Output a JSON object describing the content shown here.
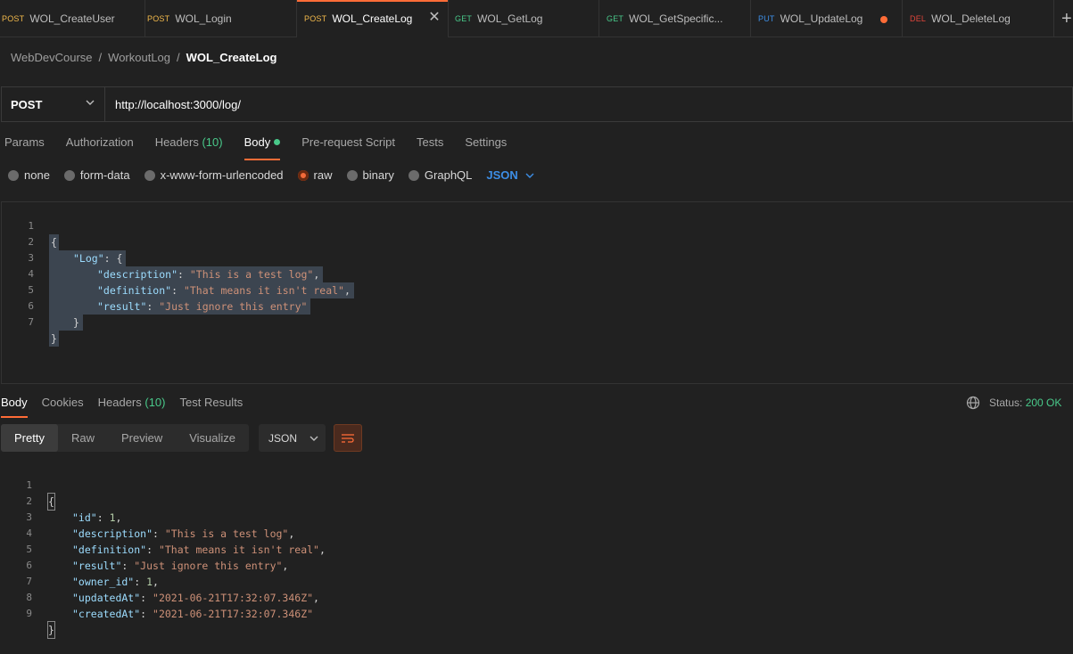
{
  "tabs": [
    {
      "method": "POST",
      "color": "#f2b94b",
      "name": "WOL_CreateUser"
    },
    {
      "method": "POST",
      "color": "#f2b94b",
      "name": "WOL_Login"
    },
    {
      "method": "POST",
      "color": "#f2b94b",
      "name": "WOL_CreateLog"
    },
    {
      "method": "GET",
      "color": "#49c98a",
      "name": "WOL_GetLog"
    },
    {
      "method": "GET",
      "color": "#49c98a",
      "name": "WOL_GetSpecific..."
    },
    {
      "method": "PUT",
      "color": "#3d8ee6",
      "name": "WOL_UpdateLog"
    },
    {
      "method": "DEL",
      "color": "#e0453a",
      "name": "WOL_DeleteLog"
    }
  ],
  "breadcrumb": {
    "part1": "WebDevCourse",
    "sep1": "/",
    "part2": "WorkoutLog",
    "sep2": "/",
    "current": "WOL_CreateLog"
  },
  "request": {
    "method": "POST",
    "url": "http://localhost:3000/log/"
  },
  "req_tabs": {
    "params": "Params",
    "authorization": "Authorization",
    "headers": "Headers",
    "headers_count": "(10)",
    "body": "Body",
    "prerequest": "Pre-request Script",
    "tests": "Tests",
    "settings": "Settings"
  },
  "body_types": {
    "none": "none",
    "formdata": "form-data",
    "urlencoded": "x-www-form-urlencoded",
    "raw": "raw",
    "binary": "binary",
    "graphql": "GraphQL",
    "format": "JSON"
  },
  "request_body": {
    "line_numbers": [
      "1",
      "2",
      "3",
      "4",
      "5",
      "6",
      "7"
    ],
    "open_brace": "{",
    "log_key": "\"Log\"",
    "log_open": ": {",
    "description_key": "\"description\"",
    "description_val": "\"This is a test log\"",
    "definition_key": "\"definition\"",
    "definition_val": "\"That means it isn't real\"",
    "result_key": "\"result\"",
    "result_val": "\"Just ignore this entry\"",
    "inner_close": "}",
    "close_brace": "}"
  },
  "response_tabs": {
    "body": "Body",
    "cookies": "Cookies",
    "headers": "Headers",
    "headers_count": "(10)",
    "test_results": "Test Results",
    "status_label": "Status:",
    "status_value": "200 OK"
  },
  "view_modes": {
    "pretty": "Pretty",
    "raw": "Raw",
    "preview": "Preview",
    "visualize": "Visualize",
    "format": "JSON"
  },
  "response_body": {
    "line_numbers": [
      "1",
      "2",
      "3",
      "4",
      "5",
      "6",
      "7",
      "8",
      "9"
    ],
    "open_brace": "{",
    "id_key": "\"id\"",
    "id_val": "1",
    "description_key": "\"description\"",
    "description_val": "\"This is a test log\"",
    "definition_key": "\"definition\"",
    "definition_val": "\"That means it isn't real\"",
    "result_key": "\"result\"",
    "result_val": "\"Just ignore this entry\"",
    "owner_key": "\"owner_id\"",
    "owner_val": "1",
    "updated_key": "\"updatedAt\"",
    "updated_val": "\"2021-06-21T17:32:07.346Z\"",
    "created_key": "\"createdAt\"",
    "created_val": "\"2021-06-21T17:32:07.346Z\"",
    "close_brace": "}"
  },
  "colors": {
    "accent": "#ff6c37",
    "success": "#49c98a",
    "link": "#3d8ee6"
  }
}
